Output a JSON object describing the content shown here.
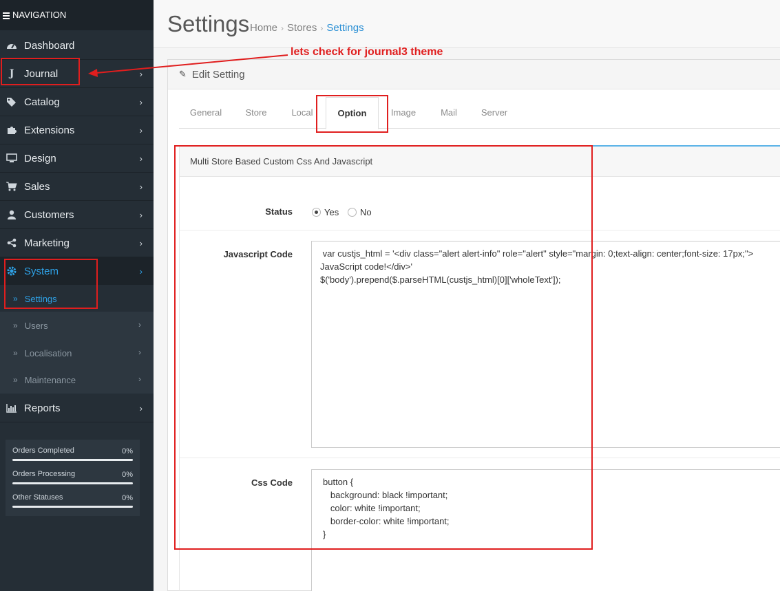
{
  "sidebar": {
    "header": "NAVIGATION",
    "items": [
      {
        "label": "Dashboard",
        "icon": "dashboard-icon"
      },
      {
        "label": "Journal",
        "icon": "journal-icon"
      },
      {
        "label": "Catalog",
        "icon": "tags-icon"
      },
      {
        "label": "Extensions",
        "icon": "puzzle-icon"
      },
      {
        "label": "Design",
        "icon": "desktop-icon"
      },
      {
        "label": "Sales",
        "icon": "cart-icon"
      },
      {
        "label": "Customers",
        "icon": "user-icon"
      },
      {
        "label": "Marketing",
        "icon": "share-icon"
      },
      {
        "label": "System",
        "icon": "gear-icon"
      },
      {
        "label": "Reports",
        "icon": "bar-chart-icon"
      }
    ],
    "system_sub": [
      {
        "label": "Settings"
      },
      {
        "label": "Users"
      },
      {
        "label": "Localisation"
      },
      {
        "label": "Maintenance"
      }
    ],
    "stats": [
      {
        "label": "Orders Completed",
        "value": "0%"
      },
      {
        "label": "Orders Processing",
        "value": "0%"
      },
      {
        "label": "Other Statuses",
        "value": "0%"
      }
    ]
  },
  "header": {
    "title": "Settings",
    "breadcrumb": [
      "Home",
      "Stores",
      "Settings"
    ]
  },
  "panel": {
    "heading": "Edit Setting",
    "tabs": [
      "General",
      "Store",
      "Local",
      "Option",
      "Image",
      "Mail",
      "Server"
    ],
    "active_tab": "Option",
    "section_title": "Multi Store Based Custom Css And Javascript",
    "status": {
      "label": "Status",
      "options": [
        "Yes",
        "No"
      ],
      "selected": "Yes"
    },
    "javascript": {
      "label": "Javascript Code",
      "value": " var custjs_html = '<div class=\"alert alert-info\" role=\"alert\" style=\"margin: 0;text-align: center;font-size: 17px;\">\nJavaScript code!</div>'\n$('body').prepend($.parseHTML(custjs_html)[0]['wholeText']);"
    },
    "css": {
      "label": "Css Code",
      "value": "button {\n   background: black !important;\n   color: white !important;\n   border-color: white !important;\n}"
    }
  },
  "annotation": {
    "text": "lets check for journal3 theme",
    "color": "#e01e1e"
  },
  "colors": {
    "sidebar_bg": "#252e36",
    "accent": "#2ea1e6",
    "annotation": "#e01e1e"
  }
}
